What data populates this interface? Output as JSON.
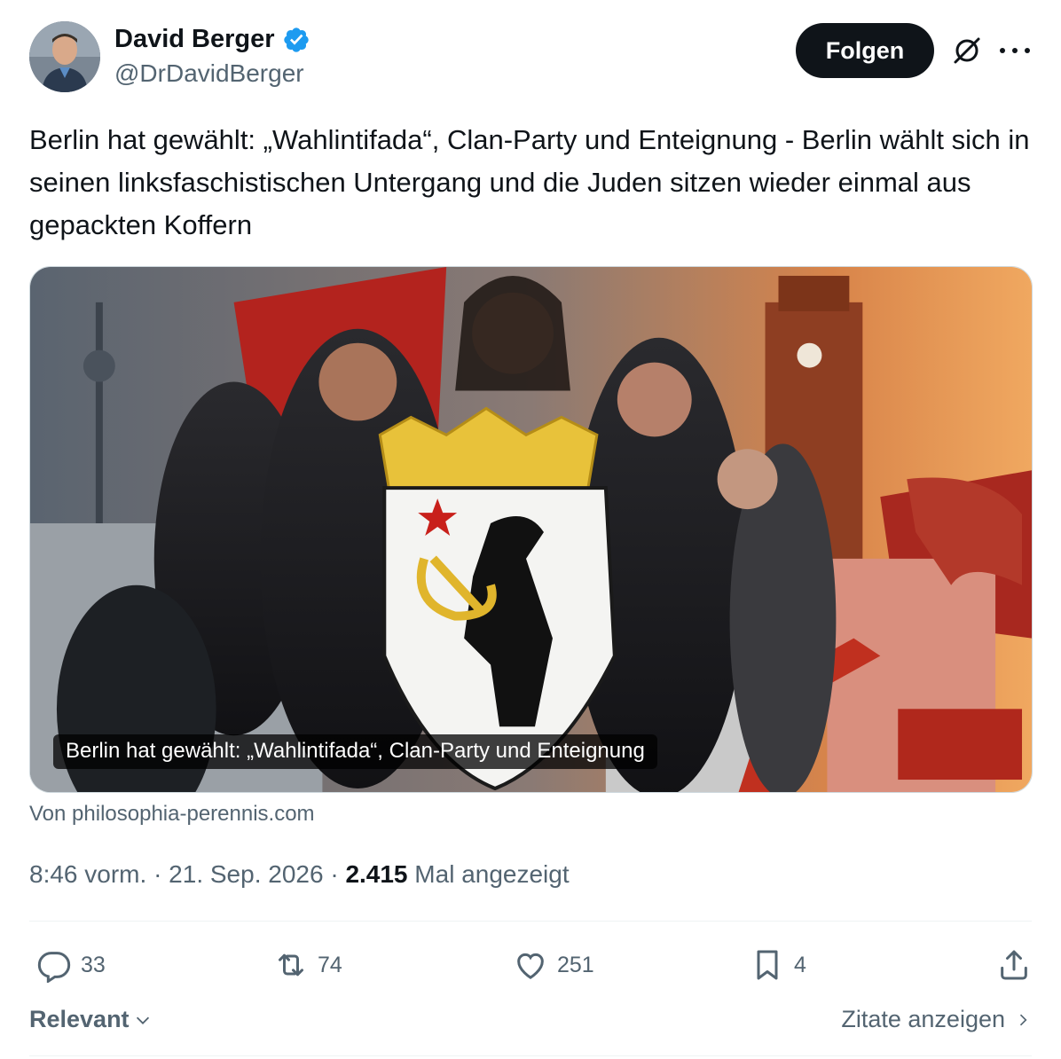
{
  "author": {
    "display_name": "David Berger",
    "handle": "@DrDavidBerger",
    "verified": true,
    "avatar_icon": "profile-photo"
  },
  "header": {
    "follow_label": "Folgen",
    "grok_icon": "slashed-circle-icon",
    "more_icon": "more-dots-icon"
  },
  "tweet": {
    "text": "Berlin hat gewählt: „Wahlintifada“, Clan-Party und Enteignung - Berlin wählt sich in seinen linksfaschistischen Untergang und die Juden sitzen wieder einmal aus gepackten Koffern"
  },
  "card": {
    "caption": "Berlin hat gewählt: „Wahlintifada“, Clan-Party und Enteignung",
    "source": "Von philosophia-perennis.com"
  },
  "meta": {
    "time": "8:46 vorm.",
    "separator": "·",
    "date": "21. Sep. 2026",
    "views_count": "2.415",
    "views_label": "Mal angezeigt"
  },
  "actions": {
    "replies": "33",
    "reposts": "74",
    "likes": "251",
    "bookmarks": "4"
  },
  "footer": {
    "sort_label": "Relevant",
    "quotes_label": "Zitate anzeigen"
  },
  "colors": {
    "text_primary": "#0f1419",
    "text_secondary": "#536471",
    "verified_blue": "#1d9bf0",
    "divider": "#eff3f4"
  }
}
